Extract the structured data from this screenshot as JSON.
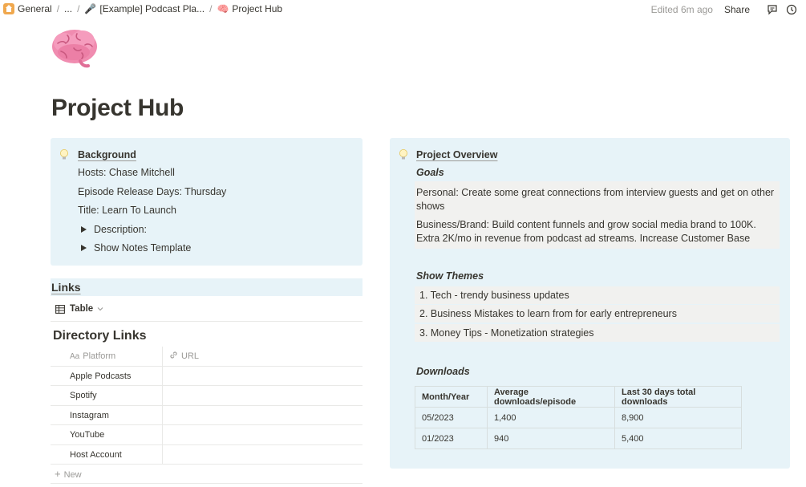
{
  "breadcrumb": {
    "items": [
      "General",
      "...",
      "[Example] Podcast Pla...",
      "Project Hub"
    ],
    "separator": "/",
    "emojis": {
      "podcast": "🎤",
      "project": "🧠"
    }
  },
  "topbar": {
    "edited": "Edited 6m ago",
    "share_label": "Share",
    "icons": [
      "comment-icon",
      "clock-icon"
    ]
  },
  "page": {
    "icon": "brain-icon",
    "title": "Project Hub"
  },
  "background_callout": {
    "icon": "lightbulb-icon",
    "heading": "Background",
    "hosts": "Hosts: Chase Mitchell",
    "release_days": "Episode Release Days: Thursday",
    "title": "Title: Learn To Launch",
    "toggles": [
      "Description:",
      "Show Notes Template"
    ]
  },
  "overview_callout": {
    "icon": "lightbulb-icon",
    "heading": "Project Overview",
    "goals_heading": "Goals",
    "goals": [
      "Personal: Create some great connections from interview guests and get on other shows",
      "Business/Brand: Build content funnels and grow social media brand to 100K. Extra 2K/mo in revenue from podcast ad streams. Increase Customer Base"
    ],
    "themes_heading": "Show Themes",
    "themes": [
      "1.  Tech - trendy business updates",
      "2.  Business Mistakes to learn from for early entrepreneurs",
      "3.  Money Tips - Monetization strategies"
    ],
    "downloads_heading": "Downloads",
    "downloads_table": {
      "headers": [
        "Month/Year",
        "Average downloads/episode",
        "Last 30 days total downloads"
      ],
      "rows": [
        [
          "05/2023",
          "1,400",
          "8,900"
        ],
        [
          "01/2023",
          "940",
          "5,400"
        ]
      ]
    }
  },
  "links": {
    "heading": "Links",
    "view_label": "Table",
    "database_title": "Directory Links",
    "columns": [
      "Platform",
      "URL"
    ],
    "column_icons": [
      "Aa",
      "link-icon"
    ],
    "rows": [
      "Apple Podcasts",
      "Spotify",
      "Instagram",
      "YouTube",
      "Host Account"
    ],
    "new_label": "New"
  },
  "colors": {
    "callout_bg": "#e7f3f8",
    "block_bg": "#f1f1ef",
    "text": "#37352f",
    "muted": "#9b9a97"
  }
}
